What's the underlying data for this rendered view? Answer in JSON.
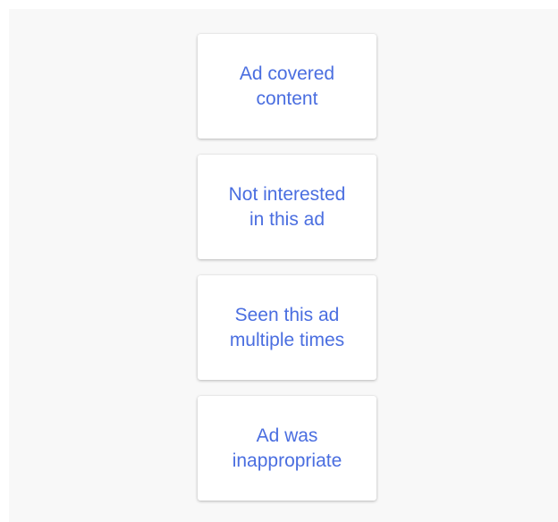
{
  "feedback_options": [
    {
      "label": "Ad covered\ncontent"
    },
    {
      "label": "Not interested\nin this ad"
    },
    {
      "label": "Seen this ad\nmultiple times"
    },
    {
      "label": "Ad was\ninappropriate"
    }
  ],
  "colors": {
    "link_text": "#4a6ee0",
    "panel_background": "#f8f8f8",
    "button_background": "#ffffff"
  }
}
